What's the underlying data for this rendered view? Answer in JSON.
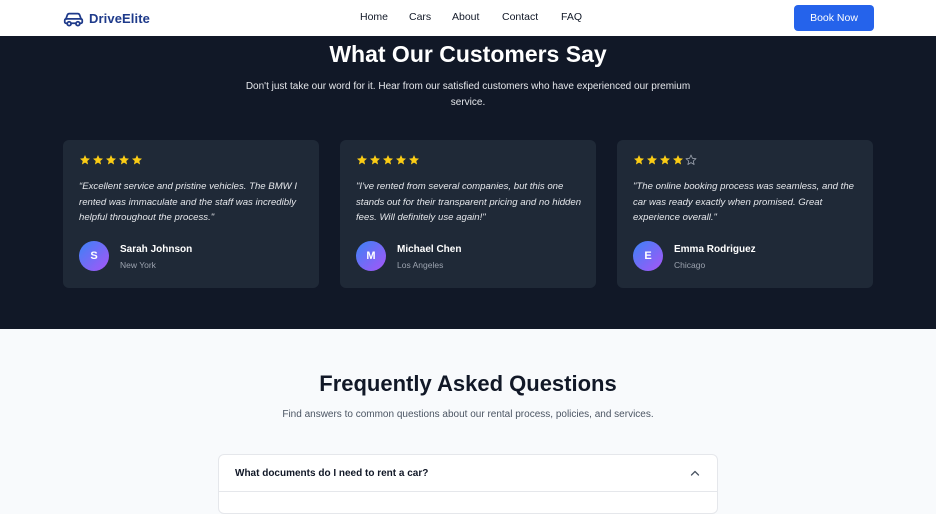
{
  "header": {
    "brand": "DriveElite",
    "nav": [
      "Home",
      "Cars",
      "About",
      "Contact",
      "FAQ"
    ],
    "cta": "Book Now"
  },
  "testimonials": {
    "title": "What Our Customers Say",
    "subtitle": "Don't just take our word for it. Hear from our satisfied customers who have experienced our premium service.",
    "items": [
      {
        "rating": 5,
        "quote": "“Excellent service and pristine vehicles. The BMW I rented was immaculate and the staff was incredibly helpful throughout the process.\"",
        "initial": "S",
        "name": "Sarah Johnson",
        "city": "New York"
      },
      {
        "rating": 5,
        "quote": "\"I've rented from several companies, but this one stands out for their transparent pricing and no hidden fees. Will definitely use again!\"",
        "initial": "M",
        "name": "Michael Chen",
        "city": "Los Angeles"
      },
      {
        "rating": 4,
        "quote": "\"The online booking process was seamless, and the car was ready exactly when promised. Great experience overall.\"",
        "initial": "E",
        "name": "Emma Rodriguez",
        "city": "Chicago"
      }
    ]
  },
  "faq": {
    "title": "Frequently Asked Questions",
    "subtitle": "Find answers to common questions about our rental process, policies, and services.",
    "items": [
      {
        "question": "What documents do I need to rent a car?",
        "expanded": true
      }
    ]
  },
  "colors": {
    "accent": "#2563eb",
    "dark": "#111827",
    "card": "#1f2937",
    "star": "#facc15",
    "brand": "#1e3a8a"
  },
  "icons": {
    "brand": "car-icon",
    "rating": "star-icon",
    "toggle": "chevron-up-icon"
  }
}
